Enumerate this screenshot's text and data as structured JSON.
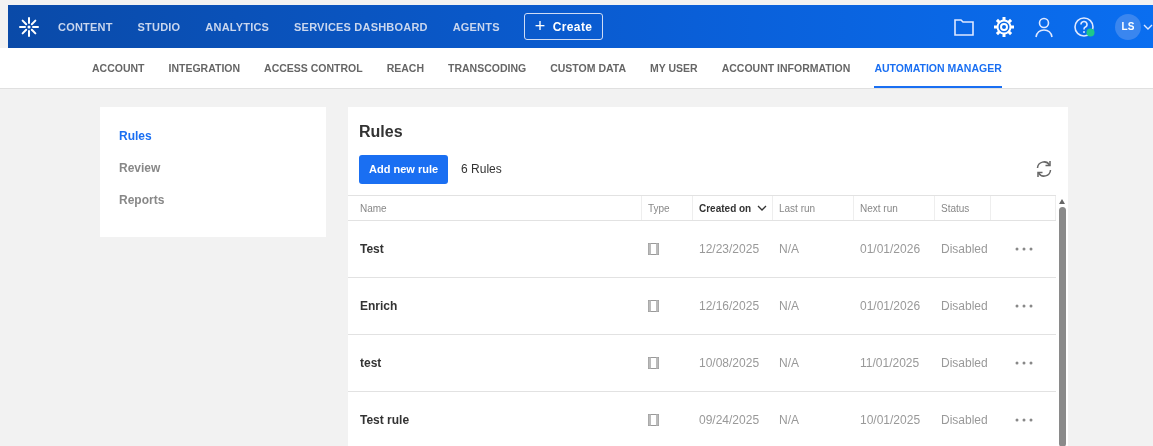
{
  "top_nav": {
    "items": [
      {
        "label": "CONTENT"
      },
      {
        "label": "STUDIO"
      },
      {
        "label": "ANALYTICS"
      },
      {
        "label": "SERVICES DASHBOARD"
      },
      {
        "label": "AGENTS"
      }
    ],
    "create_button": {
      "label": "Create",
      "icon": "+"
    },
    "avatar": {
      "initials": "LS"
    }
  },
  "sub_nav": [
    {
      "label": "ACCOUNT",
      "selected": false
    },
    {
      "label": "INTEGRATION",
      "selected": false
    },
    {
      "label": "ACCESS CONTROL",
      "selected": false
    },
    {
      "label": "REACH",
      "selected": false
    },
    {
      "label": "TRANSCODING",
      "selected": false
    },
    {
      "label": "CUSTOM DATA",
      "selected": false
    },
    {
      "label": "MY USER",
      "selected": false
    },
    {
      "label": "ACCOUNT INFORMATION",
      "selected": false
    },
    {
      "label": "AUTOMATION MANAGER",
      "selected": true
    }
  ],
  "sidebar": {
    "items": [
      {
        "label": "Rules",
        "selected": true
      },
      {
        "label": "Review",
        "selected": false
      },
      {
        "label": "Reports",
        "selected": false
      }
    ]
  },
  "rules_panel": {
    "title": "Rules",
    "add_button": "Add new rule",
    "count": "6 Rules",
    "table": {
      "columns": [
        {
          "label": "Name",
          "sorted": false
        },
        {
          "label": "Type",
          "sorted": false
        },
        {
          "label": "Created on",
          "sorted": true
        },
        {
          "label": "Last run",
          "sorted": false
        },
        {
          "label": "Next run",
          "sorted": false
        },
        {
          "label": "Status",
          "sorted": false
        }
      ],
      "rows": [
        {
          "name": "Test",
          "created_on": "12/23/2025",
          "last_run": "N/A",
          "next_run": "01/01/2026",
          "status": "Disabled"
        },
        {
          "name": "Enrich",
          "created_on": "12/16/2025",
          "last_run": "N/A",
          "next_run": "01/01/2026",
          "status": "Disabled"
        },
        {
          "name": "test",
          "created_on": "10/08/2025",
          "last_run": "N/A",
          "next_run": "11/01/2025",
          "status": "Disabled"
        },
        {
          "name": "Test rule",
          "created_on": "09/24/2025",
          "last_run": "N/A",
          "next_run": "10/01/2025",
          "status": "Disabled"
        }
      ]
    }
  }
}
